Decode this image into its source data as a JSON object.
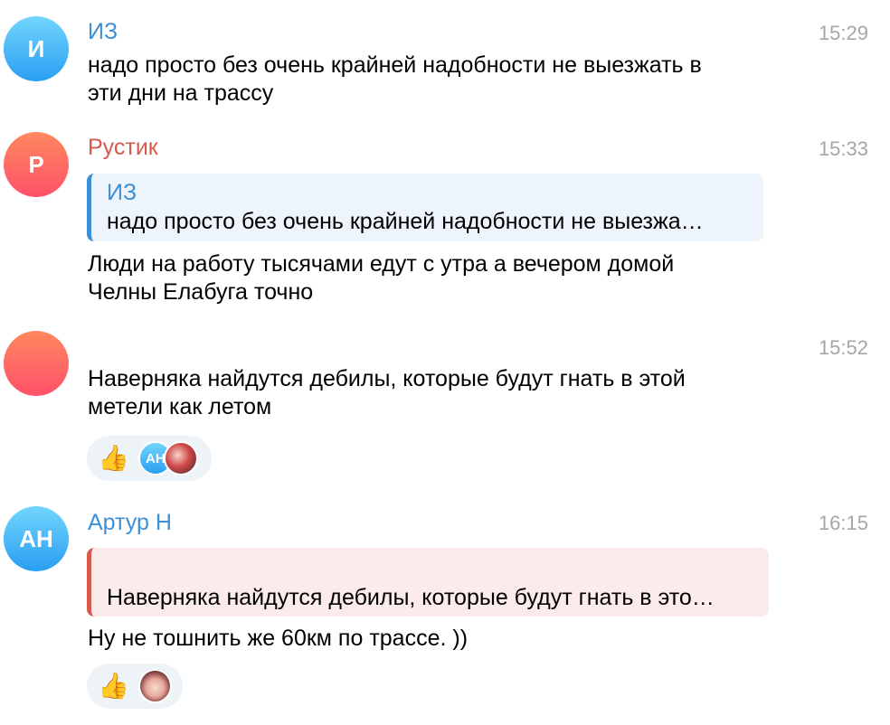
{
  "messages": [
    {
      "avatar_letter": "И",
      "sender": "ИЗ",
      "time": "15:29",
      "text_lines": [
        "надо просто без очень крайней надобности не выезжать в",
        "эти дни на трассу"
      ]
    },
    {
      "avatar_letter": "Р",
      "sender": "Рустик",
      "time": "15:33",
      "reply": {
        "name": "ИЗ",
        "text": "надо просто без очень крайней надобности не выезжа…"
      },
      "text_lines": [
        "Люди на работу тысячами едут с утра а вечером домой",
        "Челны Елабуга точно"
      ]
    },
    {
      "time": "15:52",
      "text_lines": [
        "Наверняка найдутся дебилы, которые будут гнать в этой",
        "метели как летом"
      ],
      "reactions": {
        "emoji": "👍",
        "avatar_initials": "АН"
      }
    },
    {
      "avatar_letter": "АН",
      "sender": "Артур Н",
      "time": "16:15",
      "reply": {
        "name": "",
        "text": "Наверняка найдутся дебилы, которые будут гнать в это…"
      },
      "text_lines": [
        "Ну не тошнить же 60км по трассе. ))"
      ],
      "reactions": {
        "emoji": "👍"
      }
    }
  ],
  "colors": {
    "sender_blue": "#3d8fd6",
    "sender_red": "#d65a4d",
    "time_gray": "#a6a6a6",
    "reaction_bg": "#eef3f8"
  }
}
